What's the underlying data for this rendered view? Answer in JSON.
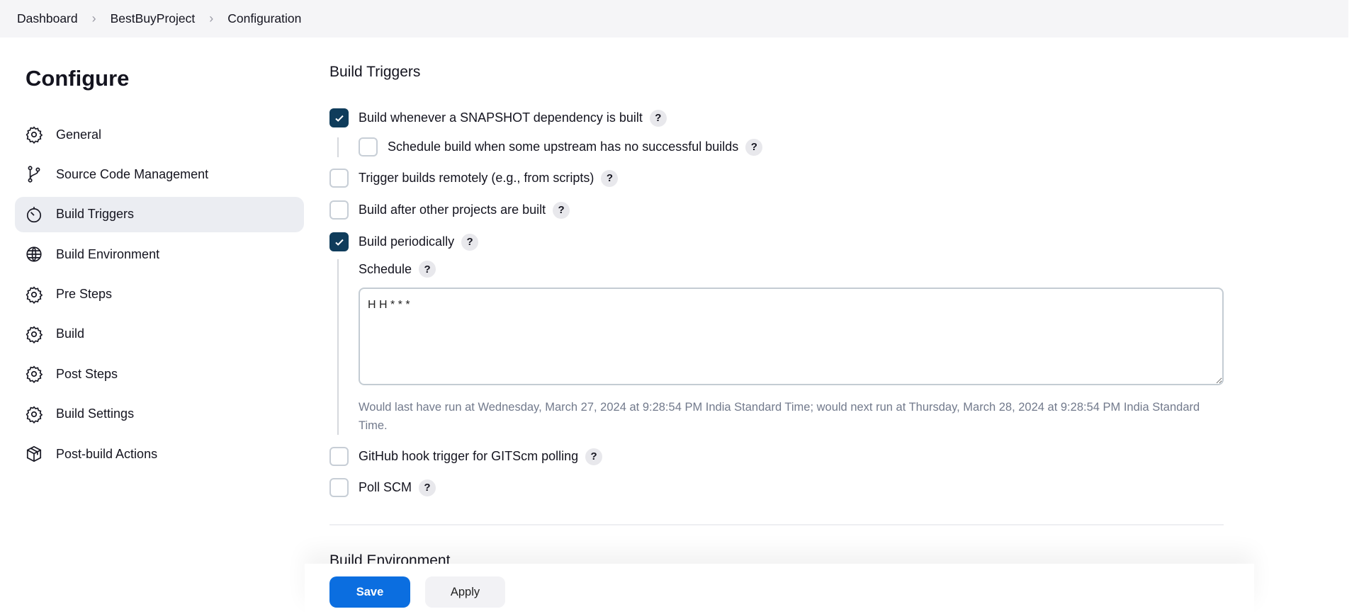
{
  "breadcrumb": [
    "Dashboard",
    "BestBuyProject",
    "Configuration"
  ],
  "page_title": "Configure",
  "sidebar": {
    "items": [
      {
        "label": "General",
        "icon": "gear-icon"
      },
      {
        "label": "Source Code Management",
        "icon": "branch-icon"
      },
      {
        "label": "Build Triggers",
        "icon": "timer-icon",
        "active": true
      },
      {
        "label": "Build Environment",
        "icon": "globe-icon"
      },
      {
        "label": "Pre Steps",
        "icon": "gear-icon"
      },
      {
        "label": "Build",
        "icon": "gear-icon"
      },
      {
        "label": "Post Steps",
        "icon": "gear-icon"
      },
      {
        "label": "Build Settings",
        "icon": "gear-icon"
      },
      {
        "label": "Post-build Actions",
        "icon": "package-icon"
      }
    ]
  },
  "section_title": "Build Triggers",
  "triggers": [
    {
      "label": "Build whenever a SNAPSHOT dependency is built",
      "checked": true
    },
    {
      "label": "Schedule build when some upstream has no successful builds",
      "checked": false
    },
    {
      "label": "Trigger builds remotely (e.g., from scripts)",
      "checked": false
    },
    {
      "label": "Build after other projects are built",
      "checked": false
    },
    {
      "label": "Build periodically",
      "checked": true
    },
    {
      "label": "GitHub hook trigger for GITScm polling",
      "checked": false
    },
    {
      "label": "Poll SCM",
      "checked": false
    }
  ],
  "schedule": {
    "label": "Schedule",
    "value": "H H * * *",
    "hint": "Would last have run at Wednesday, March 27, 2024 at 9:28:54 PM India Standard Time; would next run at Thursday, March 28, 2024 at 9:28:54 PM India Standard Time."
  },
  "help_glyph": "?",
  "next_section": "Build Environment",
  "buttons": {
    "save": "Save",
    "apply": "Apply"
  },
  "colors": {
    "accent": "#0b6ee0",
    "checkbox": "#0f3c5b"
  }
}
